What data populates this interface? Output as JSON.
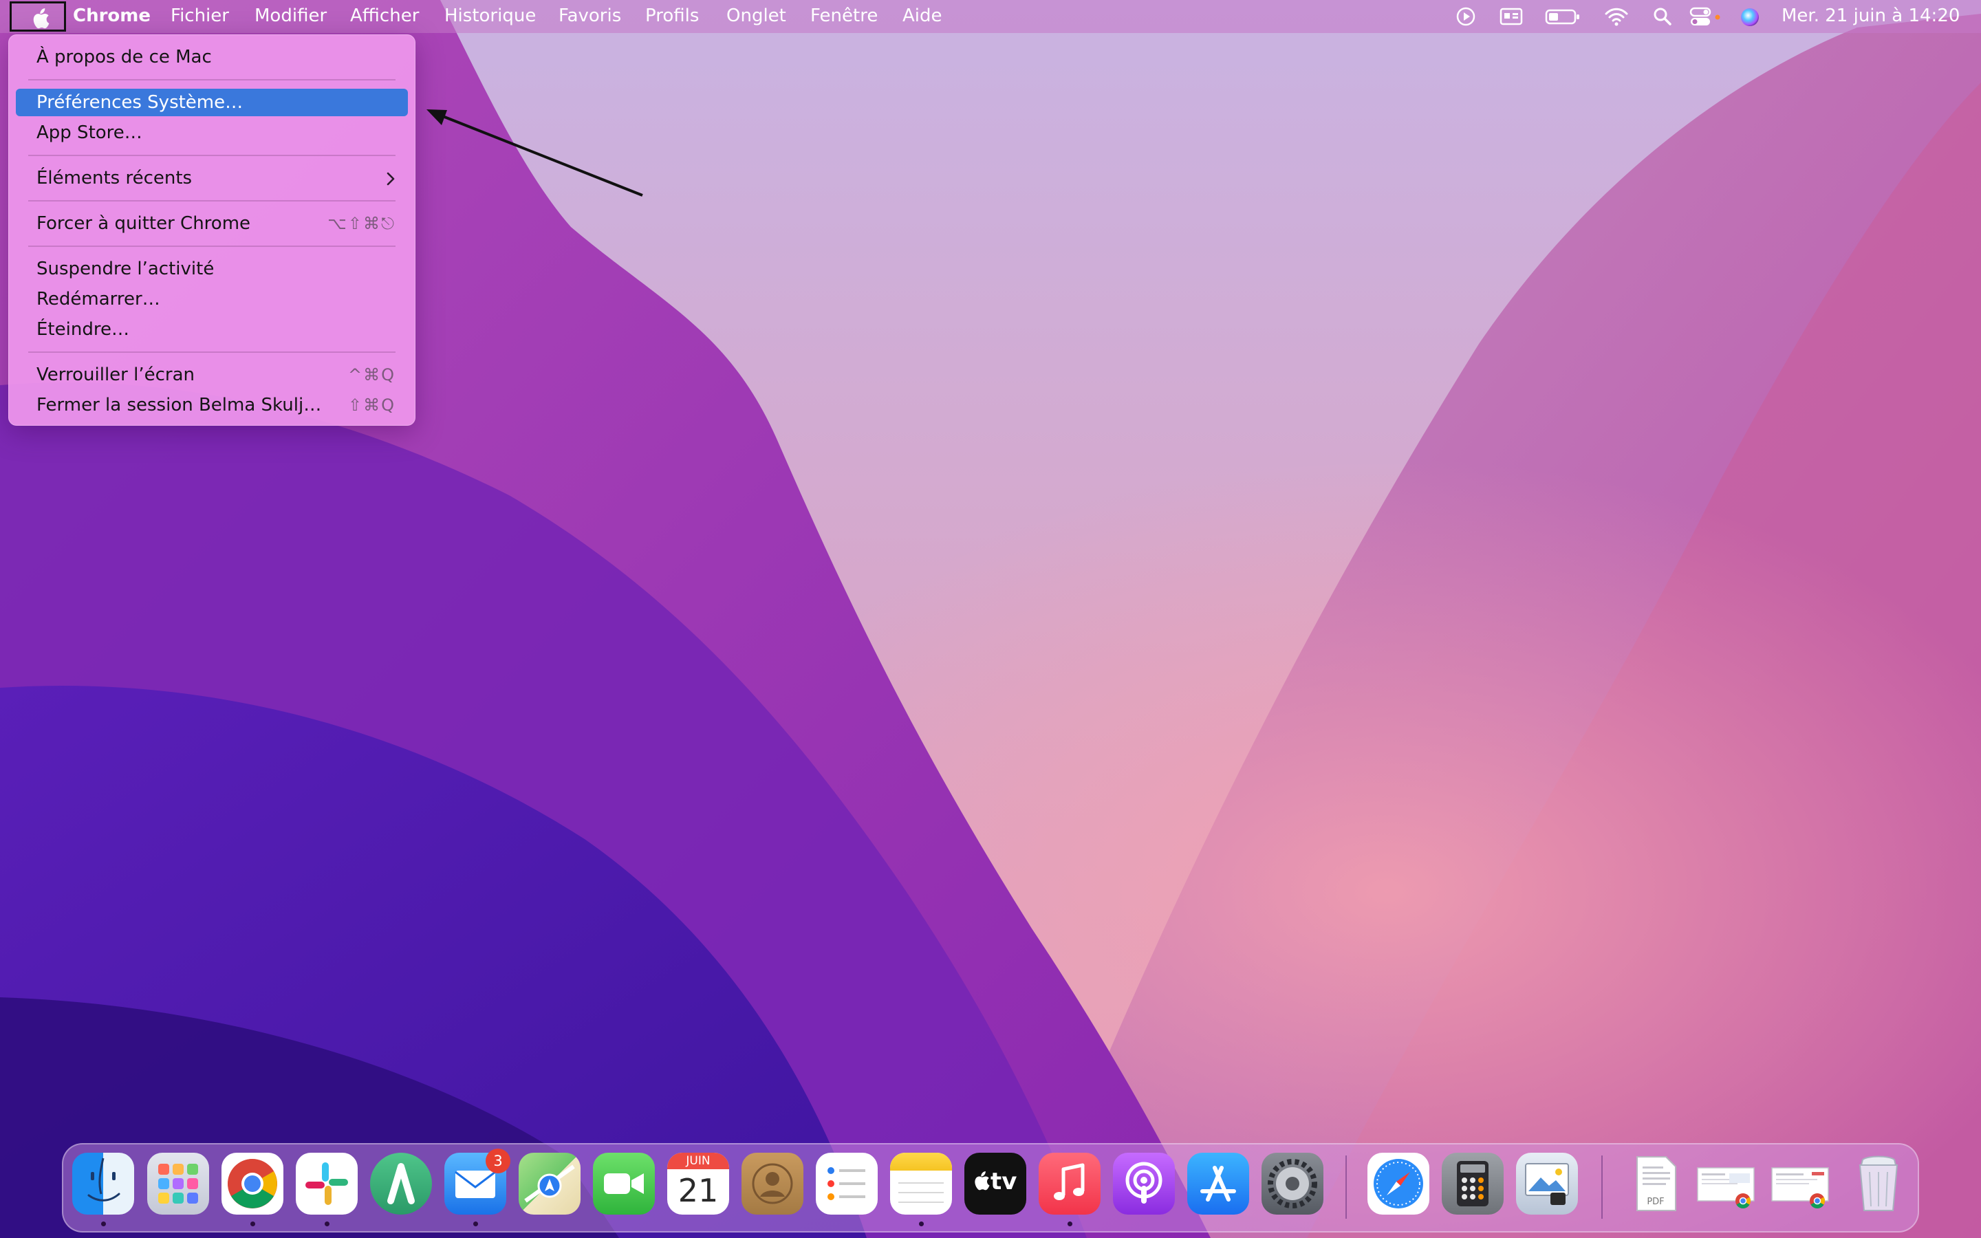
{
  "menubar": {
    "app_name": "Chrome",
    "menus": [
      "Fichier",
      "Modifier",
      "Afficher",
      "Historique",
      "Favoris",
      "Profils",
      "Onglet",
      "Fenêtre",
      "Aide"
    ],
    "status_icons": [
      "screen-record-icon",
      "display-icon",
      "battery-icon",
      "wifi-icon",
      "spotlight-search-icon",
      "control-center-icon",
      "siri-icon"
    ],
    "clock": "Mer. 21 juin à  14:20"
  },
  "apple_menu": {
    "about": "À propos de ce Mac",
    "system_prefs": "Préférences Système…",
    "app_store": "App Store…",
    "recent_items": "Éléments récents",
    "force_quit": "Forcer à quitter Chrome",
    "force_quit_shortcut": "⌥⇧⌘⎋",
    "sleep": "Suspendre l’activité",
    "restart": "Redémarrer…",
    "shutdown": "Éteindre…",
    "lock_screen": "Verrouiller l’écran",
    "lock_screen_shortcut": "^⌘Q",
    "logout": "Fermer la session Belma Skulj…",
    "logout_shortcut": "⇧⌘Q"
  },
  "dock": {
    "mail_badge": "3",
    "calendar_month": "JUIN",
    "calendar_day": "21",
    "tv_label": "tv",
    "pdf_label": "PDF",
    "apps": [
      "finder-icon",
      "launchpad-icon",
      "chrome-icon",
      "slack-icon",
      "arc-icon",
      "mail-icon",
      "maps-icon",
      "facetime-icon",
      "calendar-icon",
      "contacts-icon",
      "reminders-icon",
      "notes-icon",
      "apple-tv-icon",
      "music-icon",
      "podcasts-icon",
      "app-store-icon",
      "system-preferences-icon",
      "safari-icon",
      "calculator-icon",
      "preview-icon",
      "pdf-document-icon",
      "chrome-window-thumbnail-icon",
      "chrome-window-thumbnail-icon",
      "trash-icon"
    ]
  },
  "colors": {
    "menu_highlight": "#3a78dc",
    "menu_background": "#ee96ec",
    "badge_red": "#e8402f"
  }
}
